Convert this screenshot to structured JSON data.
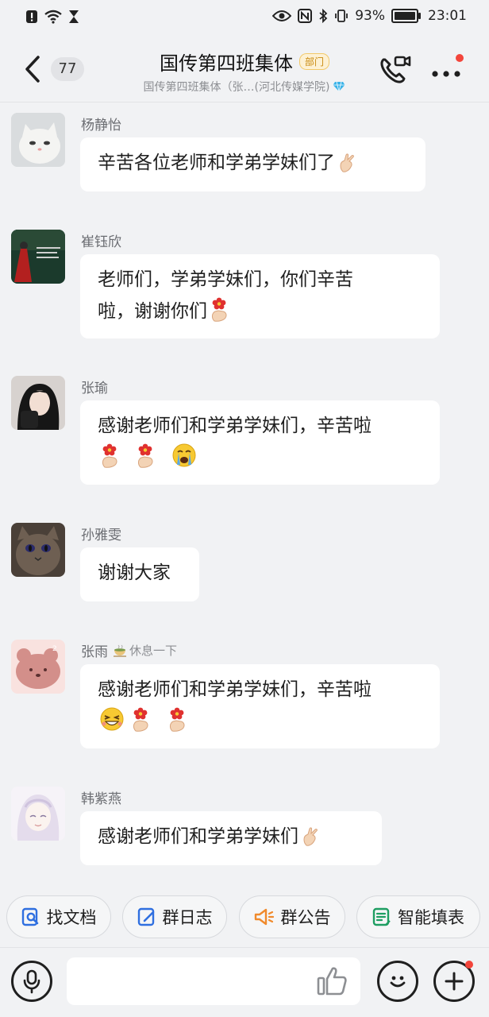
{
  "status_bar": {
    "battery_percent_text": "93%",
    "time": "23:01"
  },
  "header": {
    "unread_count": "77",
    "title": "国传第四班集体",
    "badge": "部门",
    "subtitle": "国传第四班集体（张…(河北传媒学院)"
  },
  "messages": [
    {
      "sender": "杨静怡",
      "text": "辛苦各位老师和学弟学妹们了",
      "emojis": [
        "finger-heart"
      ]
    },
    {
      "sender": "崔钰欣",
      "text_line1": "老师们，学弟学妹们，你们辛苦",
      "text_line2": "啦，谢谢你们",
      "emojis": [
        "flower-hand"
      ]
    },
    {
      "sender": "张瑜",
      "text": "感谢老师们和学弟学妹们，辛苦啦",
      "emojis": [
        "flower-hand",
        "flower-hand",
        "crying-face"
      ]
    },
    {
      "sender": "孙雅雯",
      "text": "谢谢大家",
      "emojis": []
    },
    {
      "sender": "张雨",
      "status": "休息一下",
      "text": "感谢老师们和学弟学妹们，辛苦啦",
      "emojis": [
        "laughing-face",
        "flower-hand",
        "flower-hand"
      ]
    },
    {
      "sender": "韩紫燕",
      "text": "感谢老师们和学弟学妹们",
      "emojis": [
        "finger-heart"
      ]
    }
  ],
  "quick_actions": [
    {
      "label": "找文档",
      "icon": "find-document-icon",
      "color": "#2f6fe0"
    },
    {
      "label": "群日志",
      "icon": "group-log-icon",
      "color": "#2f6fe0"
    },
    {
      "label": "群公告",
      "icon": "megaphone-icon",
      "color": "#f08a2c"
    },
    {
      "label": "智能填表",
      "icon": "smart-form-icon",
      "color": "#1e9e62"
    }
  ],
  "input": {
    "placeholder": ""
  },
  "colors": {
    "background": "#f1f2f4",
    "bubble": "#ffffff",
    "badge_text": "#c98a10",
    "notification_dot": "#f3453b",
    "verified_gem": "#3bb3e8"
  }
}
